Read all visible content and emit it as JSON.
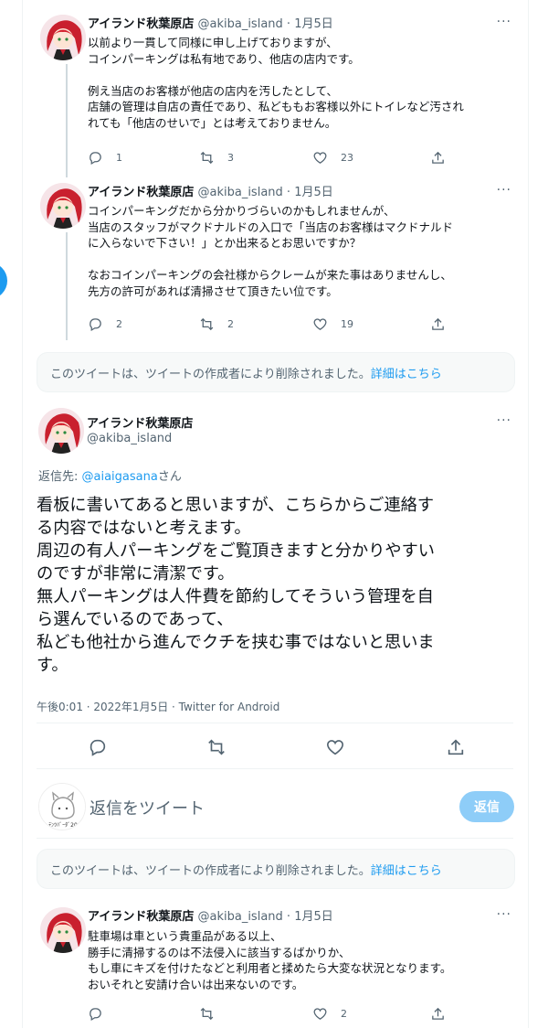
{
  "tweets": [
    {
      "name": "アイランド秋葉原店",
      "handle": "@akiba_island",
      "dot": "·",
      "date": "1月5日",
      "text": "以前より一貫して同様に申し上げておりますが、\nコインパーキングは私有地であり、他店の店内です。\n\n例え当店のお客様が他店の店内を汚したとして、\n店舗の管理は自店の責任であり、私どももお客様以外にトイレなど汚され\nれても「他店のせいで」とは考えておりません。",
      "replies": "1",
      "retweets": "3",
      "likes": "23"
    },
    {
      "name": "アイランド秋葉原店",
      "handle": "@akiba_island",
      "dot": "·",
      "date": "1月5日",
      "text": "コインパーキングだから分かりづらいのかもしれませんが、\n当店のスタッフがマクドナルドの入口で「当店のお客様はマクドナルド\nに入らないで下さい！」とか出来るとお思いですか？\n\nなおコインパーキングの会社様からクレームが来た事はありませんし、\n先方の許可があれば清掃させて頂きたい位です。",
      "replies": "2",
      "retweets": "2",
      "likes": "19"
    },
    {
      "name": "アイランド秋葉原店",
      "handle": "@akiba_island",
      "dot": "·",
      "date": "1月5日",
      "text": "駐車場は車という貴重品がある以上、\n勝手に清掃するのは不法侵入に該当するばかりか、\nもし車にキズを付けたなどと利用者と揉めたら大変な状況となります。\nおいそれと安請け合いは出来ないのです。",
      "replies": "",
      "retweets": "",
      "likes": "2"
    }
  ],
  "deleted_notice": {
    "text": "このツイートは、ツイートの作成者により削除されました。",
    "link": "詳細はこちら"
  },
  "main_tweet": {
    "name": "アイランド秋葉原店",
    "handle": "@akiba_island",
    "reply_prefix": "返信先: ",
    "reply_mention": "@aiaigasana",
    "reply_suffix": "さん",
    "text": "看板に書いてあると思いますが、こちらからご連絡す\nる内容ではないと考えます。\n周辺の有人パーキングをご覧頂きますと分かりやすい\nのですが非常に清潔です。\n無人パーキングは人件費を節約してそういう管理を自\nら選んでいるのであって、\n私ども他社から進んでクチを挟む事ではないと思いま\nす。",
    "meta": "午後0:01 · 2022年1月5日 · Twitter for Android"
  },
  "reply_composer": {
    "placeholder": "返信をツイート",
    "button": "返信",
    "avatar_caption": "ﾃﾝﾂﾊﾞｰﾀﾞ20"
  },
  "more_glyph": "···",
  "colors": {
    "accent": "#1d9bf0",
    "text": "#0f1419",
    "secondary": "#536471",
    "reply_button": "#8ecdf8"
  },
  "icons": [
    "reply-icon",
    "retweet-icon",
    "like-icon",
    "share-icon",
    "more-icon"
  ]
}
